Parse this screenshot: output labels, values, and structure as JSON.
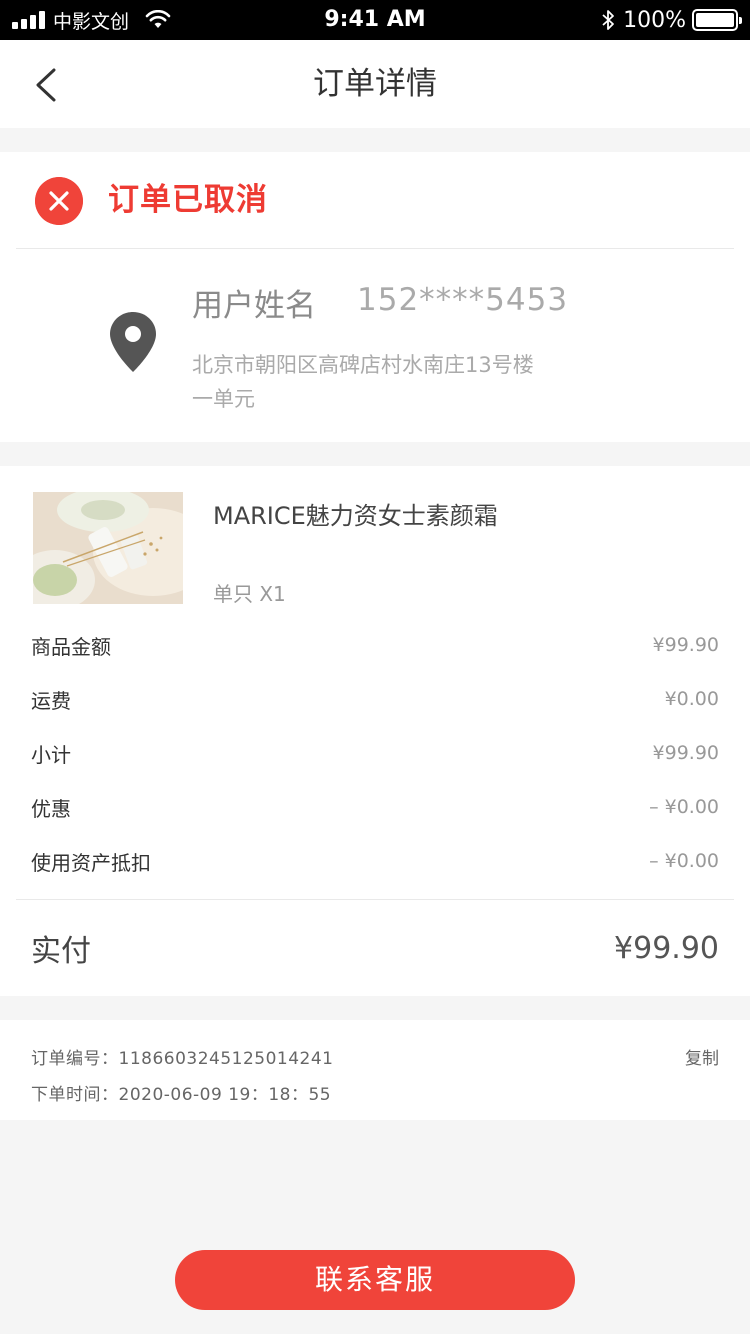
{
  "status_bar": {
    "carrier": "中影文创",
    "time": "9:41 AM",
    "battery": "100%"
  },
  "nav": {
    "title": "订单详情"
  },
  "order_status": {
    "text": "订单已取消",
    "color": "#ee3b33"
  },
  "address": {
    "name": "用户姓名",
    "phone": "152****5453",
    "line1": "北京市朝阳区高碑店村水南庄13号楼",
    "line2": "一单元"
  },
  "product": {
    "name": "MARICE魅力资女士素颜霜",
    "spec": "单只   X1"
  },
  "pricing": {
    "rows": [
      {
        "label": "商品金额",
        "value": "¥99.90"
      },
      {
        "label": "运费",
        "value": "¥0.00"
      },
      {
        "label": "小计",
        "value": "¥99.90"
      },
      {
        "label": "优惠",
        "value": "– ¥0.00"
      },
      {
        "label": "使用资产抵扣",
        "value": "– ¥0.00"
      }
    ],
    "total_label": "实付",
    "total_value": "¥99.90"
  },
  "order_info": {
    "number": "订单编号：1186603245125014241",
    "time": "下单时间：2020-06-09 19：18：55",
    "copy_label": "复制"
  },
  "contact_button": "联系客服",
  "colors": {
    "accent": "#f0443a",
    "background": "#f5f5f5"
  }
}
